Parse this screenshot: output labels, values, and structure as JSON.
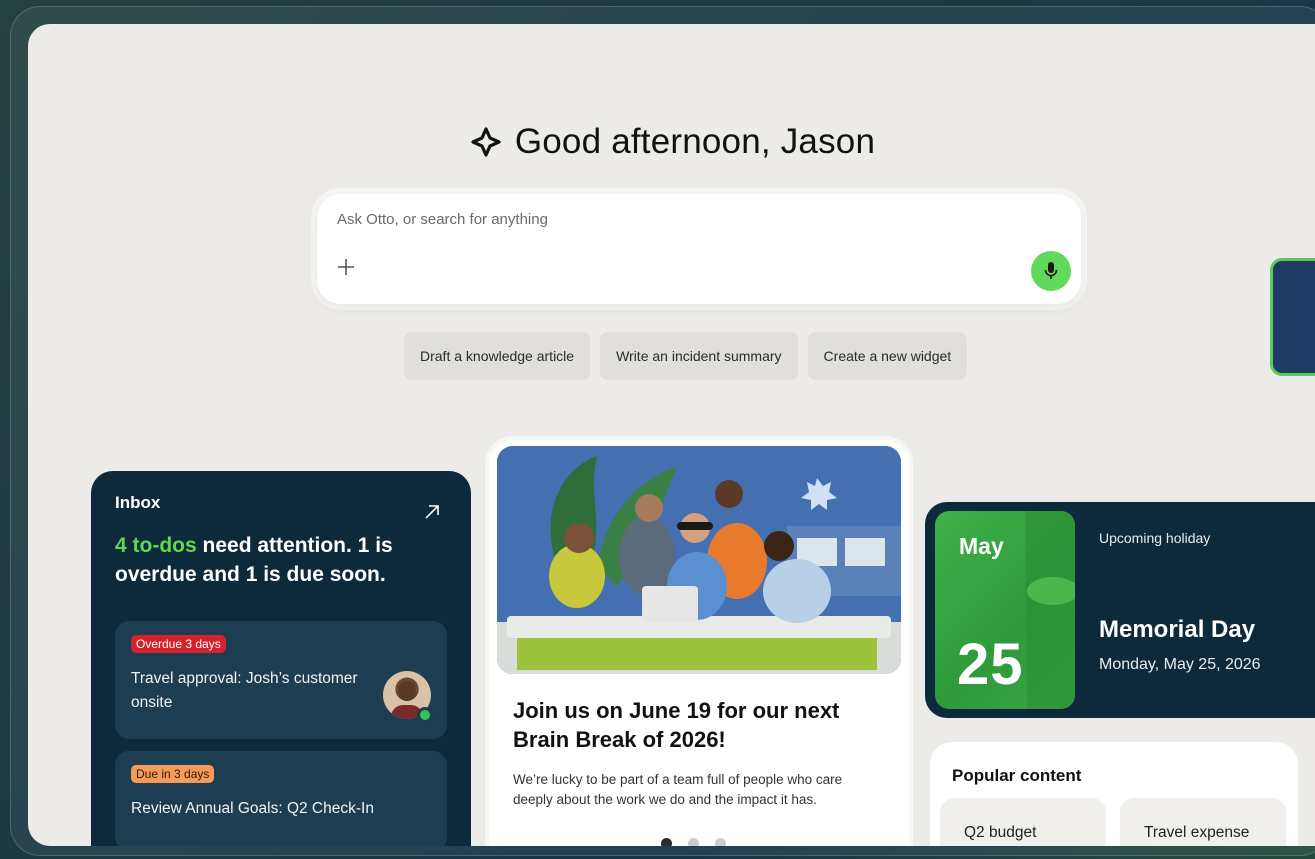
{
  "greeting": {
    "text": "Good afternoon, Jason"
  },
  "search": {
    "placeholder": "Ask Otto, or search for anything"
  },
  "suggestions": [
    {
      "label": "Draft a knowledge article"
    },
    {
      "label": "Write an incident summary"
    },
    {
      "label": "Create a new widget"
    }
  ],
  "inbox": {
    "title": "Inbox",
    "highlight": "4 to-dos",
    "summary_rest": " need attention. 1 is overdue and 1 is due soon.",
    "items": [
      {
        "badge": "Overdue 3 days",
        "text": "Travel approval: Josh’s customer onsite"
      },
      {
        "badge": "Due in 3 days",
        "text": "Review Annual Goals: Q2 Check-In"
      }
    ]
  },
  "event": {
    "title": "Join us on June 19 for our next Brain Break of 2026!",
    "body": "We’re lucky to be part of a team full of people who care deeply about the work we do and the impact it has."
  },
  "holiday": {
    "label": "Upcoming holiday",
    "month": "May",
    "day": "25",
    "name": "Memorial Day",
    "date": "Monday, May 25, 2026"
  },
  "popular": {
    "title": "Popular content",
    "items": [
      {
        "label": "Q2 budget"
      },
      {
        "label": "Travel expense"
      }
    ]
  },
  "colors": {
    "accent_green": "#61d95d",
    "navy": "#0d2a3d",
    "overdue_red": "#d6222a",
    "due_orange": "#f59a59"
  }
}
